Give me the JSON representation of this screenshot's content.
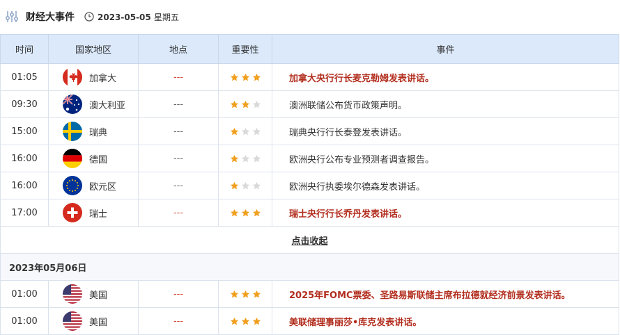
{
  "header": {
    "title": "财经大事件",
    "date": "2023-05-05",
    "weekday": "星期五"
  },
  "columns": [
    "时间",
    "国家地区",
    "地点",
    "重要性",
    "事件"
  ],
  "rows": [
    {
      "time": "01:05",
      "country": "加拿大",
      "flag": "canada-flag",
      "place": "---",
      "stars": 3,
      "event": "加拿大央行行长麦克勒姆发表讲话。",
      "high": true
    },
    {
      "time": "09:30",
      "country": "澳大利亚",
      "flag": "australia-flag",
      "place": "---",
      "stars": 2,
      "event": "澳洲联储公布货币政策声明。",
      "high": false
    },
    {
      "time": "15:00",
      "country": "瑞典",
      "flag": "sweden-flag",
      "place": "---",
      "stars": 1,
      "event": "瑞典央行行长泰登发表讲话。",
      "high": false
    },
    {
      "time": "16:00",
      "country": "德国",
      "flag": "germany-flag",
      "place": "---",
      "stars": 1,
      "event": "欧洲央行公布专业预测者调查报告。",
      "high": false
    },
    {
      "time": "16:00",
      "country": "欧元区",
      "flag": "eu-flag",
      "place": "---",
      "stars": 1,
      "event": "欧洲央行执委埃尔德森发表讲话。",
      "high": false
    },
    {
      "time": "17:00",
      "country": "瑞士",
      "flag": "switzerland-flag",
      "place": "---",
      "stars": 3,
      "event": "瑞士央行行长乔丹发表讲话。",
      "high": true
    }
  ],
  "collapse_label": "点击收起",
  "date_group": "2023年05月06日",
  "rows2": [
    {
      "time": "01:00",
      "country": "美国",
      "flag": "usa-flag",
      "place": "---",
      "stars": 3,
      "event": "2025年FOMC票委、圣路易斯联储主席布拉德就经济前景发表讲话。",
      "high": true
    },
    {
      "time": "01:00",
      "country": "美国",
      "flag": "usa-flag",
      "place": "---",
      "stars": 3,
      "event": "美联储理事丽莎•库克发表讲话。",
      "high": true
    }
  ],
  "colors": {
    "star_on": "#f0a020",
    "star_off": "#d9d9d9",
    "high_text": "#b22d1d",
    "header_bg": "#dbe9fb"
  }
}
